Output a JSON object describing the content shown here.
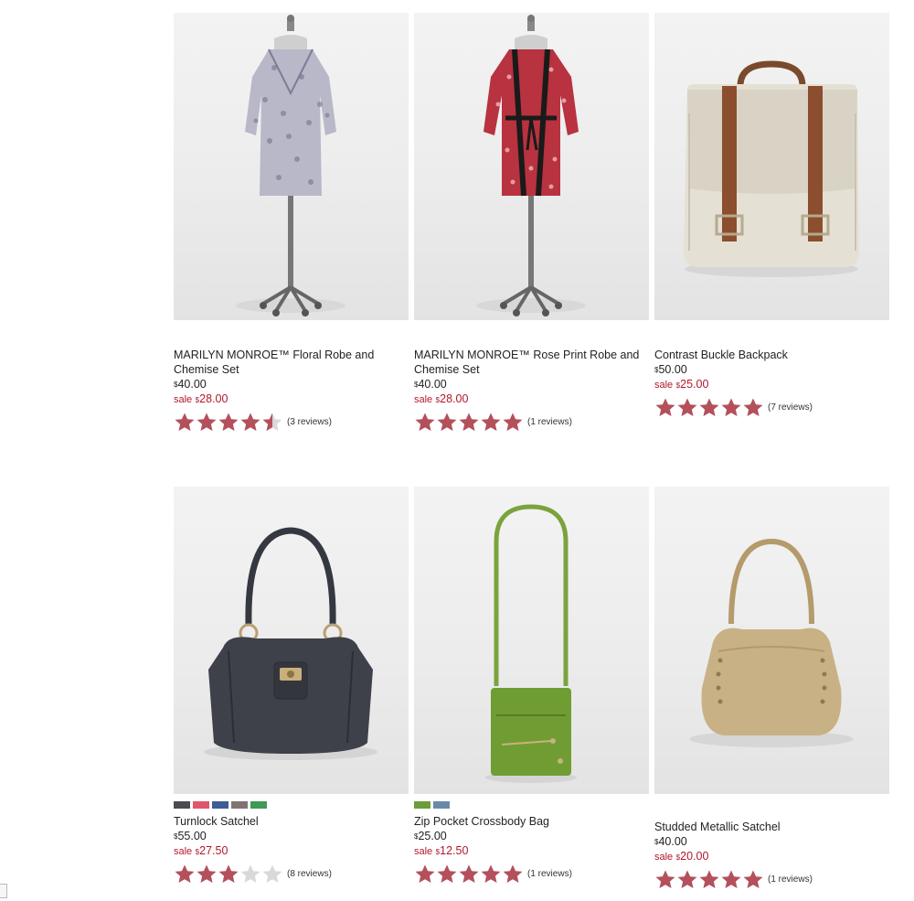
{
  "products": [
    {
      "name": "MARILYN MONROE™ Floral Robe and Chemise Set",
      "image": "floral-robe-on-dress-form",
      "price": "40.00",
      "sale_label": "sale",
      "sale_price": "28.00",
      "rating": 4.5,
      "reviews": "(3 reviews)",
      "swatches": []
    },
    {
      "name": "MARILYN MONROE™ Rose Print Robe and Chemise Set",
      "image": "rose-print-robe-on-dress-form",
      "price": "40.00",
      "sale_label": "sale",
      "sale_price": "28.00",
      "rating": 5,
      "reviews": "(1 reviews)",
      "swatches": []
    },
    {
      "name": "Contrast Buckle Backpack",
      "image": "canvas-backpack-brown-straps",
      "price": "50.00",
      "sale_label": "sale",
      "sale_price": "25.00",
      "rating": 5,
      "reviews": "(7 reviews)",
      "swatches": []
    },
    {
      "name": "Turnlock Satchel",
      "image": "charcoal-turnlock-satchel",
      "price": "55.00",
      "sale_label": "sale",
      "sale_price": "27.50",
      "rating": 3,
      "reviews": "(8 reviews)",
      "swatches": [
        "#4a4c52",
        "#e0566b",
        "#3f5c94",
        "#807473",
        "#3f9a55"
      ]
    },
    {
      "name": "Zip Pocket Crossbody Bag",
      "image": "green-crossbody-bag",
      "price": "25.00",
      "sale_label": "sale",
      "sale_price": "12.50",
      "rating": 5,
      "reviews": "(1 reviews)",
      "swatches": [
        "#6c9c39",
        "#6b88a8"
      ]
    },
    {
      "name": "Studded Metallic Satchel",
      "image": "gold-metallic-studded-satchel",
      "price": "40.00",
      "sale_label": "sale",
      "sale_price": "20.00",
      "rating": 5,
      "reviews": "(1 reviews)",
      "swatches": []
    }
  ],
  "colors": {
    "star_filled": "#b4505c",
    "star_empty": "#d9d9d9",
    "sale_text": "#b2182b"
  },
  "currency_symbol": "$"
}
